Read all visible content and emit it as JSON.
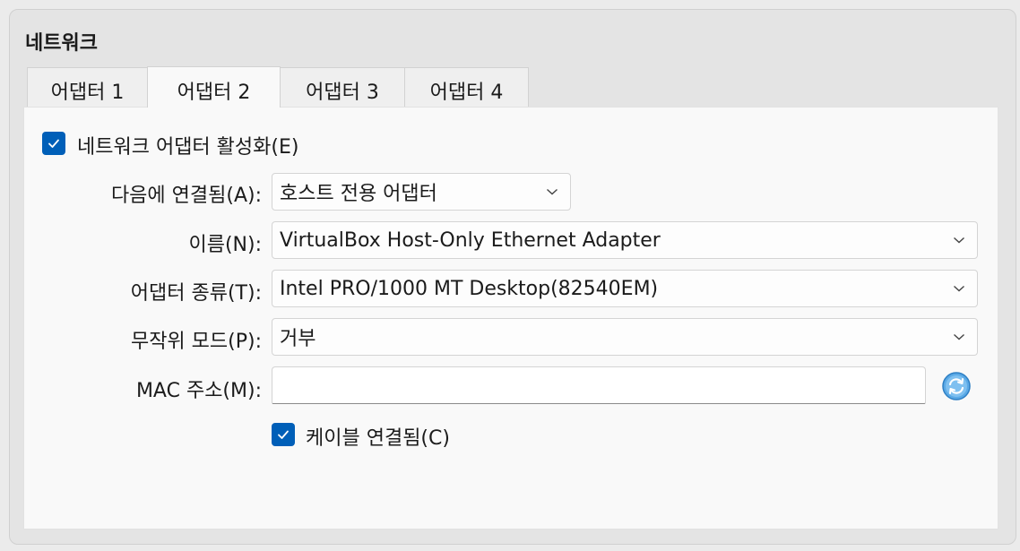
{
  "section": {
    "title": "네트워크"
  },
  "tabs": [
    {
      "label": "어댑터 1",
      "active": false
    },
    {
      "label": "어댑터 2",
      "active": true
    },
    {
      "label": "어댑터 3",
      "active": false
    },
    {
      "label": "어댑터 4",
      "active": false
    }
  ],
  "enable_adapter": {
    "label": "네트워크 어댑터 활성화(E)",
    "checked": true
  },
  "fields": {
    "attached_to": {
      "label": "다음에 연결됨(A):",
      "value": "호스트 전용 어댑터"
    },
    "name": {
      "label": "이름(N):",
      "value": "VirtualBox Host-Only Ethernet Adapter"
    },
    "adapter_type": {
      "label": "어댑터 종류(T):",
      "value": "Intel PRO/1000 MT Desktop(82540EM)"
    },
    "promiscuous": {
      "label": "무작위 모드(P):",
      "value": "거부"
    },
    "mac": {
      "label": "MAC 주소(M):",
      "value": ""
    }
  },
  "cable_connected": {
    "label": "케이블 연결됨(C)",
    "checked": true
  },
  "icons": {
    "checkmark": "check-icon",
    "dropdown": "chevron-down-icon",
    "refresh": "refresh-mac-icon"
  },
  "colors": {
    "accent": "#005fb8",
    "panel": "#f9f9f9",
    "background": "#e4e4e4"
  }
}
